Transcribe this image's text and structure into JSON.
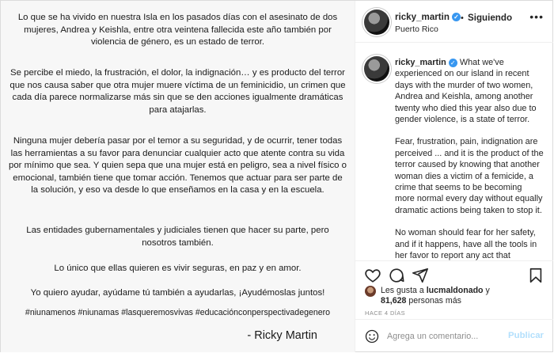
{
  "post_image": {
    "paragraphs": [
      "Lo que se ha vivido en nuestra Isla en los pasados días con el asesinato de dos mujeres, Andrea y Keishla, entre otra veintena fallecida este año también por violencia de género, es un estado de terror.",
      "Se percibe el miedo, la frustración, el dolor, la indignación… y es producto del terror que nos causa saber que otra mujer muere víctima de un feminicidio, un crimen que cada día parece normalizarse más sin que se den acciones igualmente dramáticas para atajarlas.",
      "Ninguna mujer debería pasar por el temor a su seguridad, y de ocurrir, tener todas las herramientas a su favor para denunciar cualquier acto que atente contra su vida por mínimo que sea. Y quien sepa que una mujer está en peligro, sea a nivel físico o emocional, también tiene que tomar acción. Tenemos que actuar para ser parte de la solución, y eso va desde lo que enseñamos en la casa y en la escuela.",
      "Las entidades gubernamentales y judiciales tienen que hacer su parte, pero nosotros también.",
      "Lo único que ellas quieren es vivir seguras, en paz y en amor.",
      "Yo quiero ayudar, ayúdame tú también a ayudarlas, ¡Ayudémoslas juntos!"
    ],
    "hashtags": "#niunamenos #niunamas #lasqueremosvivas #educaciónconperspectivadegenero",
    "signature": "- Ricky Martin"
  },
  "header": {
    "username": "ricky_martin",
    "separator": "•",
    "follow_label": "Siguiendo",
    "location": "Puerto Rico",
    "more": "•••"
  },
  "caption": {
    "username": "ricky_martin",
    "paragraphs": [
      "What we've experienced on our island in recent days with the murder of two women, Andrea and Keishla, among another twenty who died this year also due to gender violence, is a state of terror.",
      "Fear, frustration, pain, indignation are perceived ... and it is the product of the terror caused by knowing that another woman dies a victim of a femicide, a crime that seems to be becoming more normal every day without equally dramatic actions being taken to stop it.",
      "No woman should fear for her safety, and if it happens, have all the tools in her favor to report any act that"
    ]
  },
  "likes": {
    "line1_prefix": "Les gusta a ",
    "line1_user": "lucmaldonado",
    "line1_suffix": " y",
    "line2_count": "81,628",
    "line2_suffix": " personas más"
  },
  "timestamp": "Hace 4 días",
  "comment": {
    "placeholder": "Agrega un comentario...",
    "post_label": "Publicar"
  },
  "colors": {
    "verified": "#3897f0",
    "post_button_disabled": "#b2dffc",
    "muted_text": "#8e8e8e"
  }
}
